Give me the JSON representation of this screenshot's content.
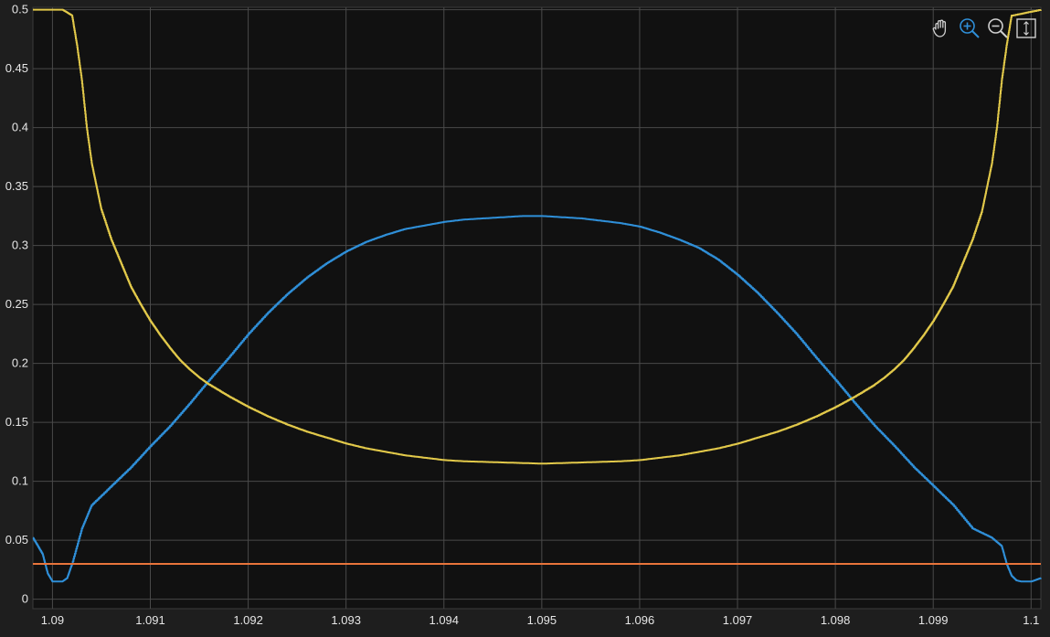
{
  "toolbar": {
    "pan": "pan-hand-icon",
    "zoom_in": "zoom-in-icon",
    "zoom_out": "zoom-out-icon",
    "restore_view": "restore-view-icon"
  },
  "colors": {
    "background": "#1e1e1e",
    "axes_background": "#111111",
    "grid": "#4a4a4a",
    "tick_text": "#e6e6e6",
    "series_1": "#2f8fd8",
    "series_2": "#e2c94a",
    "series_3": "#e8743b",
    "toolbar_active": "#2f8fd8"
  },
  "chart_data": {
    "type": "line",
    "title": "",
    "xlabel": "",
    "ylabel": "",
    "xlim": [
      1.0898,
      1.1001
    ],
    "ylim": [
      -0.008,
      0.502
    ],
    "grid": true,
    "legend": "none",
    "x_ticks": [
      "1.09",
      "1.091",
      "1.092",
      "1.093",
      "1.094",
      "1.095",
      "1.096",
      "1.097",
      "1.098",
      "1.099",
      "1.1"
    ],
    "y_ticks": [
      "0",
      "0.05",
      "0.1",
      "0.15",
      "0.2",
      "0.25",
      "0.3",
      "0.35",
      "0.4",
      "0.45",
      "0.5"
    ],
    "series": [
      {
        "color": "#2f8fd8",
        "step": true,
        "x": [
          1.0898,
          1.0899,
          1.08995,
          1.09,
          1.0901,
          1.09015,
          1.0902,
          1.0903,
          1.0904,
          1.0906,
          1.0908,
          1.091,
          1.0912,
          1.0914,
          1.0916,
          1.0918,
          1.092,
          1.0922,
          1.0924,
          1.0926,
          1.0928,
          1.093,
          1.0932,
          1.0934,
          1.0936,
          1.0938,
          1.094,
          1.0942,
          1.0944,
          1.0946,
          1.0948,
          1.095,
          1.0952,
          1.0954,
          1.0956,
          1.0958,
          1.096,
          1.0962,
          1.0964,
          1.0966,
          1.0968,
          1.097,
          1.0972,
          1.0974,
          1.0976,
          1.0978,
          1.098,
          1.0982,
          1.0984,
          1.0986,
          1.0988,
          1.099,
          1.0992,
          1.0994,
          1.0996,
          1.0997,
          1.09975,
          1.0998,
          1.09985,
          1.0999,
          1.1,
          1.1001
        ],
        "y": [
          0.052,
          0.038,
          0.022,
          0.015,
          0.015,
          0.018,
          0.03,
          0.06,
          0.08,
          0.096,
          0.112,
          0.13,
          0.147,
          0.166,
          0.186,
          0.205,
          0.225,
          0.243,
          0.259,
          0.273,
          0.285,
          0.295,
          0.303,
          0.309,
          0.314,
          0.317,
          0.32,
          0.322,
          0.323,
          0.324,
          0.325,
          0.325,
          0.324,
          0.323,
          0.321,
          0.319,
          0.316,
          0.311,
          0.305,
          0.298,
          0.288,
          0.275,
          0.26,
          0.243,
          0.225,
          0.205,
          0.186,
          0.166,
          0.147,
          0.13,
          0.112,
          0.096,
          0.08,
          0.06,
          0.052,
          0.045,
          0.03,
          0.02,
          0.016,
          0.015,
          0.015,
          0.018
        ]
      },
      {
        "color": "#e2c94a",
        "step": true,
        "x": [
          1.0898,
          1.0901,
          1.0902,
          1.09025,
          1.0903,
          1.09035,
          1.0904,
          1.09045,
          1.0905,
          1.0906,
          1.0907,
          1.0908,
          1.0909,
          1.091,
          1.0911,
          1.0912,
          1.0913,
          1.0914,
          1.0915,
          1.0916,
          1.0918,
          1.092,
          1.0922,
          1.0924,
          1.0926,
          1.0928,
          1.093,
          1.0932,
          1.0934,
          1.0936,
          1.0938,
          1.094,
          1.0942,
          1.0944,
          1.0946,
          1.0948,
          1.095,
          1.0952,
          1.0954,
          1.0956,
          1.0958,
          1.096,
          1.0962,
          1.0964,
          1.0966,
          1.0968,
          1.097,
          1.0972,
          1.0974,
          1.0976,
          1.0978,
          1.098,
          1.0982,
          1.0984,
          1.0985,
          1.0986,
          1.0987,
          1.0988,
          1.0989,
          1.099,
          1.0991,
          1.0992,
          1.0993,
          1.0994,
          1.0995,
          1.09955,
          1.0996,
          1.09965,
          1.0997,
          1.09975,
          1.0998,
          1.1001
        ],
        "y": [
          0.5,
          0.5,
          0.495,
          0.47,
          0.44,
          0.4,
          0.37,
          0.35,
          0.33,
          0.305,
          0.285,
          0.265,
          0.25,
          0.236,
          0.224,
          0.213,
          0.203,
          0.195,
          0.188,
          0.182,
          0.172,
          0.163,
          0.155,
          0.148,
          0.142,
          0.137,
          0.132,
          0.128,
          0.125,
          0.122,
          0.12,
          0.118,
          0.117,
          0.1165,
          0.116,
          0.1155,
          0.115,
          0.1155,
          0.116,
          0.1165,
          0.117,
          0.118,
          0.12,
          0.122,
          0.125,
          0.128,
          0.132,
          0.137,
          0.142,
          0.148,
          0.155,
          0.163,
          0.172,
          0.182,
          0.188,
          0.195,
          0.203,
          0.213,
          0.224,
          0.236,
          0.25,
          0.265,
          0.285,
          0.305,
          0.33,
          0.35,
          0.37,
          0.4,
          0.44,
          0.47,
          0.495,
          0.5
        ]
      },
      {
        "color": "#e8743b",
        "step": false,
        "x": [
          1.0898,
          1.1001
        ],
        "y": [
          0.03,
          0.03
        ]
      }
    ]
  }
}
